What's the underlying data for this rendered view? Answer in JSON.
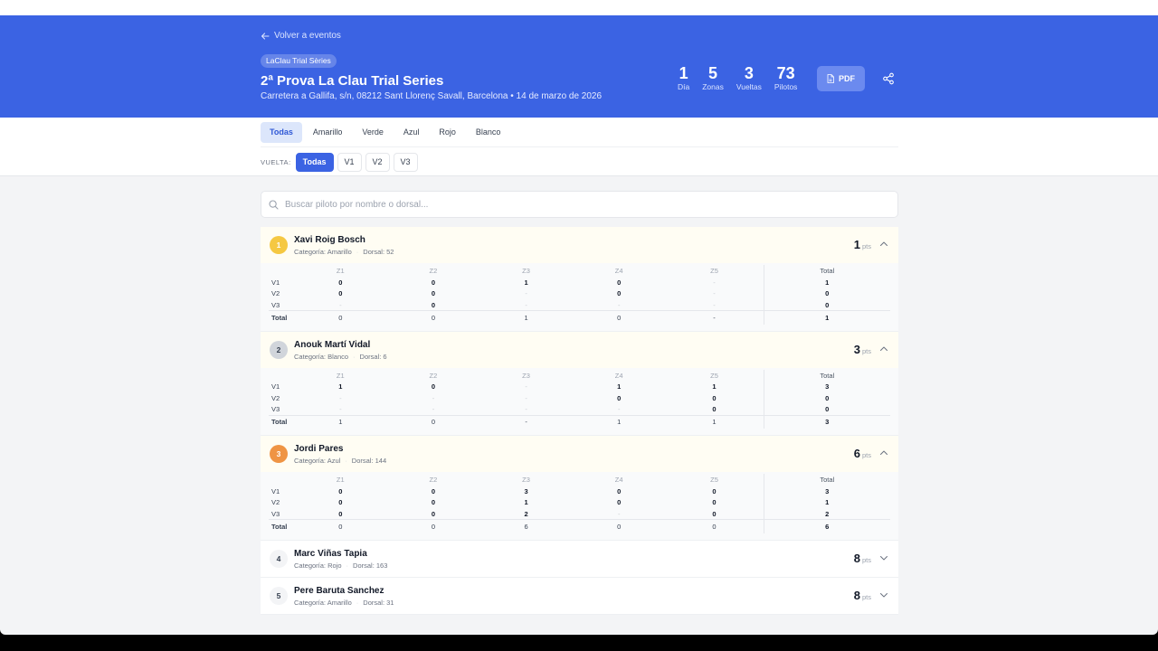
{
  "header": {
    "back_label": "Volver a eventos",
    "series_badge": "LaClau Trial Sèries",
    "title": "2ª Prova La Clau Trial Series",
    "subtitle": "Carretera a Gallifa, s/n, 08212 Sant Llorenç Savall, Barcelona • 14 de marzo de 2026",
    "stats": [
      {
        "value": "1",
        "label": "Día"
      },
      {
        "value": "5",
        "label": "Zonas"
      },
      {
        "value": "3",
        "label": "Vueltas"
      },
      {
        "value": "73",
        "label": "Pilotos"
      }
    ],
    "pdf_label": "PDF",
    "share_icon": "share-icon"
  },
  "filters": {
    "categories": [
      "Todas",
      "Amarillo",
      "Verde",
      "Azul",
      "Rojo",
      "Blanco"
    ],
    "active_category": "Todas",
    "lap_label": "VUELTA:",
    "laps": [
      "Todas",
      "V1",
      "V2",
      "V3"
    ],
    "active_lap": "Todas"
  },
  "search": {
    "placeholder": "Buscar piloto por nombre o dorsal...",
    "value": ""
  },
  "table_headers": {
    "zones": [
      "Z1",
      "Z2",
      "Z3",
      "Z4",
      "Z5"
    ],
    "total": "Total",
    "total_row": "Total",
    "laps": [
      "V1",
      "V2",
      "V3"
    ]
  },
  "riders": [
    {
      "pos": "1",
      "medal": "gold",
      "name": "Xavi Roig Bosch",
      "category": "Categoría: Amarillo",
      "dorsal": "Dorsal: 52",
      "points": "1",
      "pts_unit": "pts",
      "expanded": true,
      "rows": [
        [
          "0",
          "0",
          "1",
          "0",
          "-",
          "1"
        ],
        [
          "0",
          "0",
          "-",
          "0",
          "-",
          "0"
        ],
        [
          "-",
          "0",
          "-",
          "-",
          "-",
          "0"
        ]
      ],
      "totals": [
        "0",
        "0",
        "1",
        "0",
        "-",
        "1"
      ]
    },
    {
      "pos": "2",
      "medal": "silver",
      "name": "Anouk Martí Vidal",
      "category": "Categoría: Blanco",
      "dorsal": "Dorsal: 6",
      "points": "3",
      "pts_unit": "pts",
      "expanded": true,
      "rows": [
        [
          "1",
          "0",
          "-",
          "1",
          "1",
          "3"
        ],
        [
          "-",
          "-",
          "-",
          "0",
          "0",
          "0"
        ],
        [
          "-",
          "-",
          "-",
          "-",
          "0",
          "0"
        ]
      ],
      "totals": [
        "1",
        "0",
        "-",
        "1",
        "1",
        "3"
      ]
    },
    {
      "pos": "3",
      "medal": "bronze",
      "name": "Jordi Pares",
      "category": "Categoría: Azul",
      "dorsal": "Dorsal: 144",
      "points": "6",
      "pts_unit": "pts",
      "expanded": true,
      "rows": [
        [
          "0",
          "0",
          "3",
          "0",
          "0",
          "3"
        ],
        [
          "0",
          "0",
          "1",
          "0",
          "0",
          "1"
        ],
        [
          "0",
          "0",
          "2",
          "-",
          "0",
          "2"
        ]
      ],
      "totals": [
        "0",
        "0",
        "6",
        "0",
        "0",
        "6"
      ]
    },
    {
      "pos": "4",
      "medal": "plain",
      "name": "Marc Viñas Tapia",
      "category": "Categoría: Rojo",
      "dorsal": "Dorsal: 163",
      "points": "8",
      "pts_unit": "pts",
      "expanded": false
    },
    {
      "pos": "5",
      "medal": "plain",
      "name": "Pere Baruta Sanchez",
      "category": "Categoría: Amarillo",
      "dorsal": "Dorsal: 31",
      "points": "8",
      "pts_unit": "pts",
      "expanded": false
    }
  ]
}
